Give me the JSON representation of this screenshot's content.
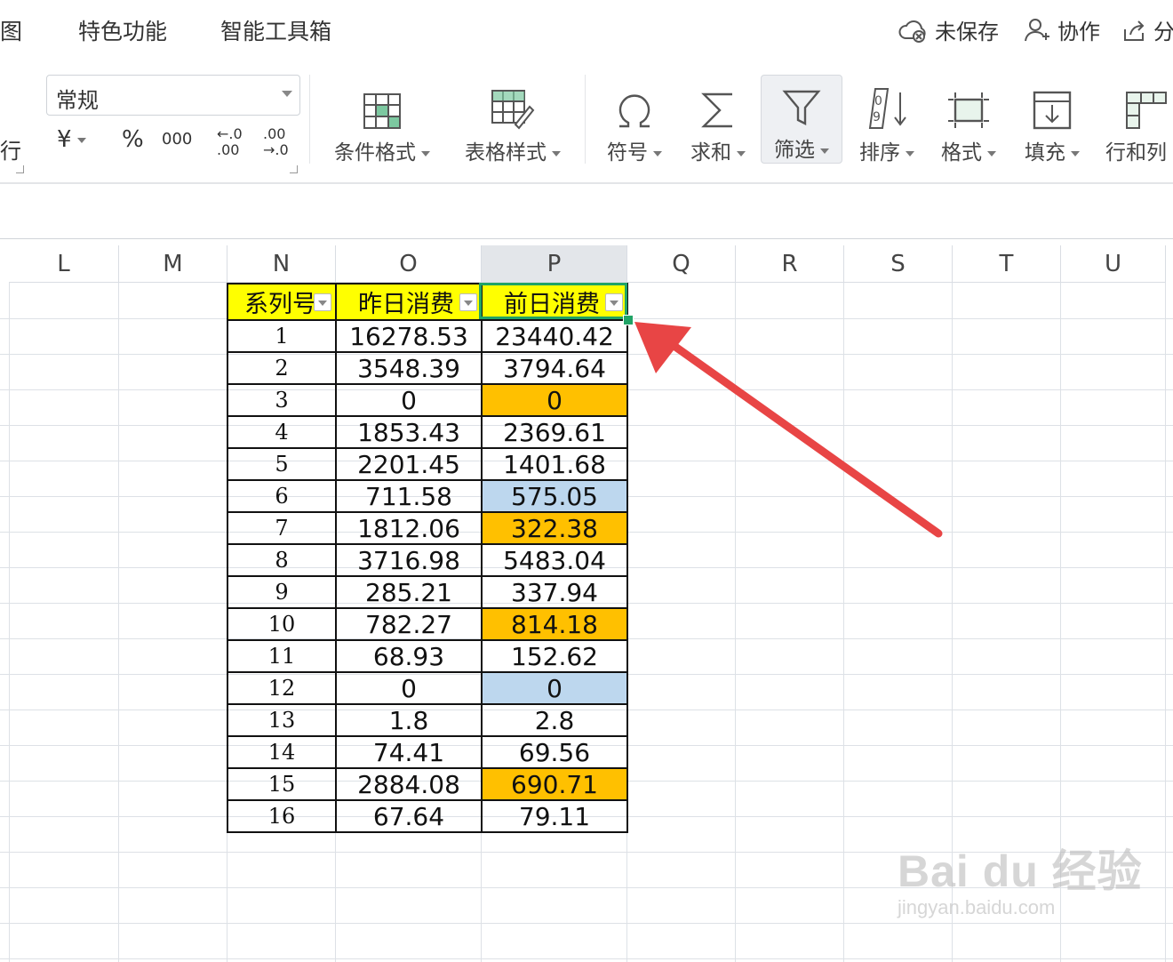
{
  "menubar": {
    "tabs": [
      "图",
      "特色功能",
      "智能工具箱"
    ],
    "status": {
      "save_state": "未保存",
      "collab": "协作",
      "share": "分"
    }
  },
  "ribbon": {
    "left_cut_label": "行",
    "number_format": {
      "selected": "常规"
    },
    "format_buttons": {
      "currency": "¥",
      "percent": "%",
      "thousands": "000",
      "inc_decimal_top": "←.0",
      "inc_decimal_bottom": ".00",
      "dec_decimal_top": ".00",
      "dec_decimal_bottom": "→.0"
    },
    "tools": {
      "cond_format": "条件格式",
      "table_style": "表格样式",
      "symbol": "符号",
      "sum": "求和",
      "filter": "筛选",
      "sort": "排序",
      "format": "格式",
      "fill": "填充",
      "row_col": "行和列"
    }
  },
  "sheet": {
    "columns": [
      "L",
      "M",
      "N",
      "O",
      "P",
      "Q",
      "R",
      "S",
      "T",
      "U"
    ],
    "selected_column": "P",
    "table": {
      "headers": {
        "seq": "系列号",
        "yesterday": "昨日消费",
        "day_before": "前日消费"
      },
      "rows": [
        {
          "seq": "1",
          "yesterday": "16278.53",
          "day_before": "23440.42",
          "highlight": ""
        },
        {
          "seq": "2",
          "yesterday": "3548.39",
          "day_before": "3794.64",
          "highlight": ""
        },
        {
          "seq": "3",
          "yesterday": "0",
          "day_before": "0",
          "highlight": "orange"
        },
        {
          "seq": "4",
          "yesterday": "1853.43",
          "day_before": "2369.61",
          "highlight": ""
        },
        {
          "seq": "5",
          "yesterday": "2201.45",
          "day_before": "1401.68",
          "highlight": ""
        },
        {
          "seq": "6",
          "yesterday": "711.58",
          "day_before": "575.05",
          "highlight": "blue"
        },
        {
          "seq": "7",
          "yesterday": "1812.06",
          "day_before": "322.38",
          "highlight": "orange"
        },
        {
          "seq": "8",
          "yesterday": "3716.98",
          "day_before": "5483.04",
          "highlight": ""
        },
        {
          "seq": "9",
          "yesterday": "285.21",
          "day_before": "337.94",
          "highlight": ""
        },
        {
          "seq": "10",
          "yesterday": "782.27",
          "day_before": "814.18",
          "highlight": "orange"
        },
        {
          "seq": "11",
          "yesterday": "68.93",
          "day_before": "152.62",
          "highlight": ""
        },
        {
          "seq": "12",
          "yesterday": "0",
          "day_before": "0",
          "highlight": "blue"
        },
        {
          "seq": "13",
          "yesterday": "1.8",
          "day_before": "2.8",
          "highlight": ""
        },
        {
          "seq": "14",
          "yesterday": "74.41",
          "day_before": "69.56",
          "highlight": ""
        },
        {
          "seq": "15",
          "yesterday": "2884.08",
          "day_before": "690.71",
          "highlight": "orange"
        },
        {
          "seq": "16",
          "yesterday": "67.64",
          "day_before": "79.11",
          "highlight": ""
        }
      ]
    }
  },
  "annotation": {
    "arrow_color": "#e84545"
  },
  "colors": {
    "header_fill": "#ffff00",
    "orange_fill": "#ffc000",
    "blue_fill": "#bdd7ee",
    "selection": "#21a366"
  },
  "watermark": {
    "main": "Bai du 经验",
    "sub": "jingyan.baidu.com"
  }
}
